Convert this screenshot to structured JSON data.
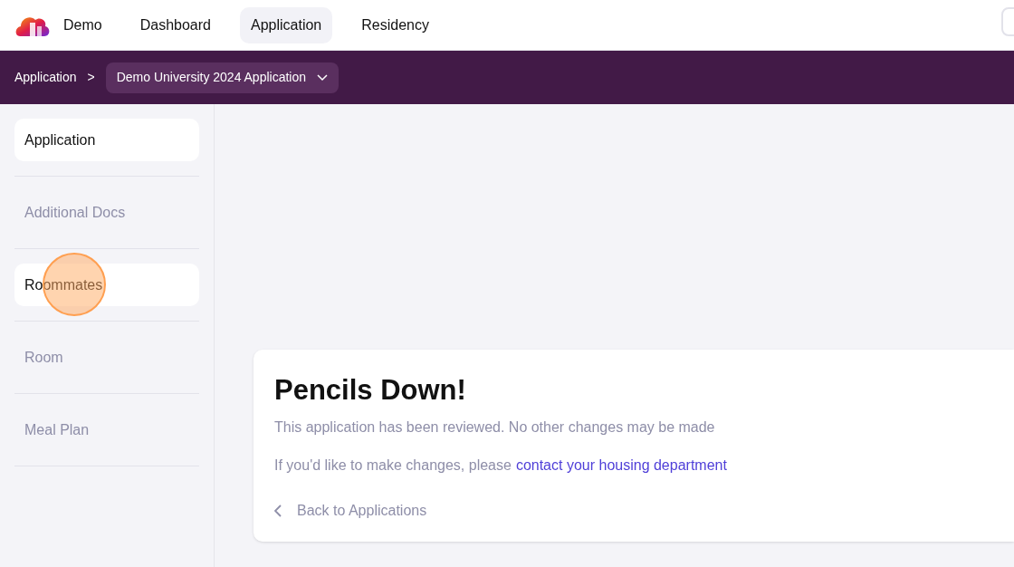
{
  "header": {
    "brand": "Demo",
    "nav": [
      {
        "label": "Dashboard",
        "selected": false
      },
      {
        "label": "Application",
        "selected": true
      },
      {
        "label": "Residency",
        "selected": false
      }
    ]
  },
  "breadcrumb": {
    "root": "Application",
    "separator": ">",
    "current": "Demo University 2024 Application"
  },
  "sidebar": {
    "items": [
      {
        "label": "Application",
        "highlighted": true
      },
      {
        "label": "Additional Docs",
        "highlighted": false
      },
      {
        "label": "Roommates",
        "highlighted": true,
        "click_marker": true
      },
      {
        "label": "Room",
        "highlighted": false
      },
      {
        "label": "Meal Plan",
        "highlighted": false
      }
    ]
  },
  "notice": {
    "title": "Pencils Down!",
    "message": "This application has been reviewed. No other changes may be made",
    "contact_text": "If you'd like to make changes, please",
    "contact_link": "contact your housing department",
    "back": "Back to Applications"
  }
}
